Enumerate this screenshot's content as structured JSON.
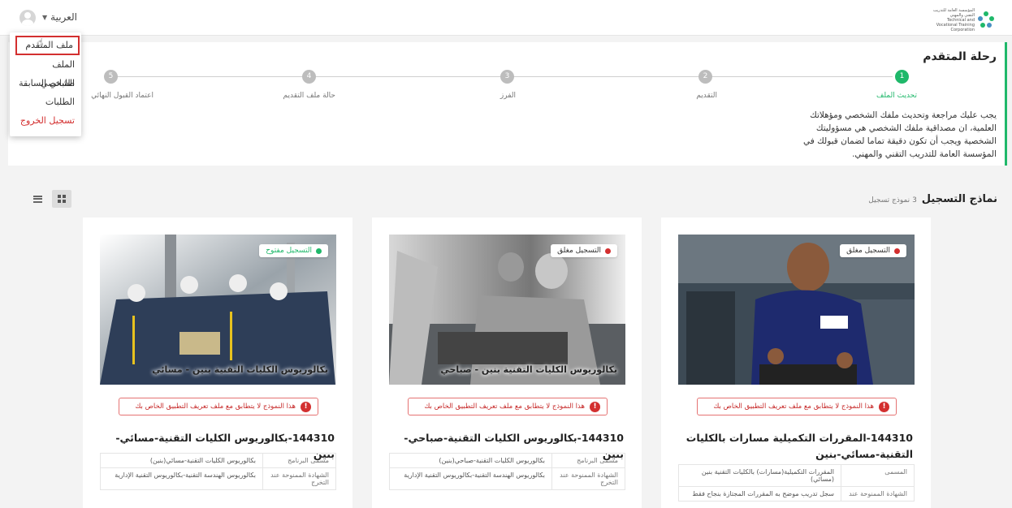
{
  "header": {
    "language_label": "العربية",
    "logo_text_ar": "المؤسسة العامة للتدريب التقني والمهني",
    "logo_text_en": "Technical and Vocational Training Corporation"
  },
  "user_menu": {
    "items": [
      {
        "label": "ملف المتقدم",
        "active": true
      },
      {
        "label": "الملف الشخصي"
      },
      {
        "label": "طلباتي السابقة"
      },
      {
        "label": "الطلبات"
      },
      {
        "label": "تسجيل الخروج",
        "danger": true
      }
    ]
  },
  "journey": {
    "title": "رحلة المتقدم",
    "steps": [
      {
        "num": "1",
        "label": "تحديث الملف",
        "done": true
      },
      {
        "num": "2",
        "label": "التقديم"
      },
      {
        "num": "3",
        "label": "الفرز"
      },
      {
        "num": "4",
        "label": "حالة ملف التقديم"
      },
      {
        "num": "5",
        "label": "اعتماد القبول النهائي"
      }
    ],
    "description": "يجب عليك مراجعة وتحديث ملفك الشخصي ومؤهلاتك العلمية، ان مصداقية ملفك الشخصي هي مسؤوليتك الشخصية ويجب أن تكون دقيقة تماما لضمان قبولك في المؤسسة العامة للتدريب التقني والمهني."
  },
  "forms": {
    "title": "نماذج التسجيل",
    "count": "3 نموذج تسجيل"
  },
  "colors": {
    "accent_green": "#1fb86a",
    "danger_red": "#d32f2f"
  },
  "cards": [
    {
      "status": "التسجيل مغلق",
      "status_color": "#d32f2f",
      "overlay_title": "",
      "warning": "هذا النموذج لا يتطابق مع ملف تعريف التطبيق الخاص بك",
      "title": "144310-المقررات التكميلية مسارات بالكليات التقنية-مسائي-بنين",
      "rows": [
        {
          "key": "المسمى",
          "value": "المقررات التكميلية(مسارات) بالكليات التقنية بنين (مسائي)"
        },
        {
          "key": "الشهادة الممنوحة عند",
          "value": "سجل تدريب موضح به المقررات المجتازة بنجاح فقط"
        }
      ]
    },
    {
      "status": "التسجيل مغلق",
      "status_color": "#d32f2f",
      "overlay_title": "بكالوريوس الكليات التقنية بنين - صباحي",
      "warning": "هذا النموذج لا يتطابق مع ملف تعريف التطبيق الخاص بك",
      "title": "144310-بكالوريوس الكليات التقنية-صباحي-بنين",
      "rows": [
        {
          "key": "مسمى البرنامج",
          "value": "بكالوريوس الكليات التقنية-صباحي(بنين)"
        },
        {
          "key": "الشهادة الممنوحة عند التخرج",
          "value": "بكالوريوس الهندسة التقنية-بكالوريوس التقنية الإدارية"
        }
      ]
    },
    {
      "status": "التسجيل مفتوح",
      "status_color": "#1fb86a",
      "overlay_title": "بكالوريوس الكليات التقنية بنين - مسائي",
      "warning": "هذا النموذج لا يتطابق مع ملف تعريف التطبيق الخاص بك",
      "title": "144310-بكالوريوس الكليات التقنية-مسائي-بنين",
      "rows": [
        {
          "key": "مسمى البرنامج",
          "value": "بكالوريوس الكليات التقنية-مسائي(بنين)"
        },
        {
          "key": "الشهادة الممنوحة عند التخرج",
          "value": "بكالوريوس الهندسة التقنية-بكالوريوس التقنية الإدارية"
        }
      ]
    }
  ]
}
